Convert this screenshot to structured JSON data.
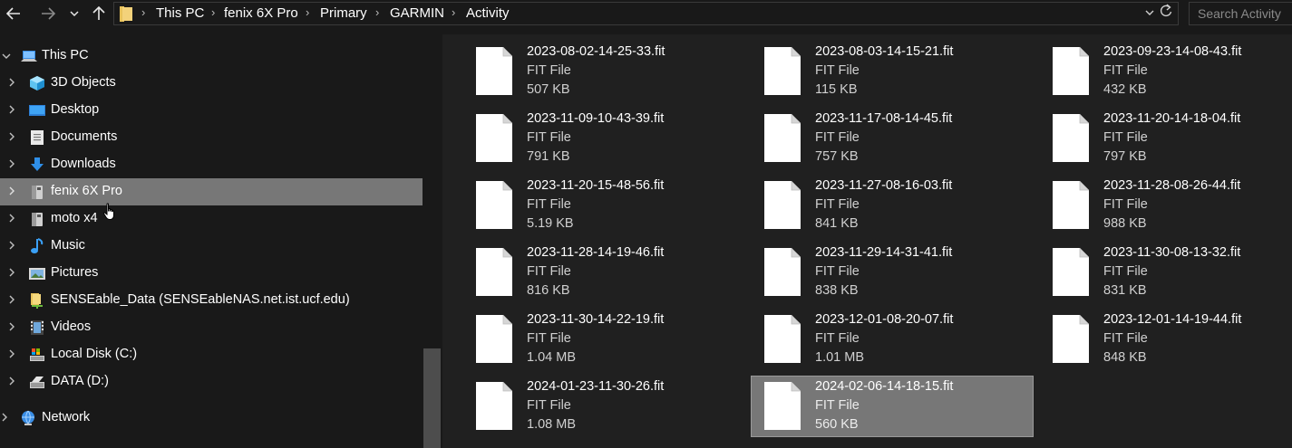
{
  "breadcrumb": [
    "This PC",
    "fenix 6X Pro",
    "Primary",
    "GARMIN",
    "Activity"
  ],
  "search": {
    "placeholder": "Search Activity"
  },
  "nav": {
    "items": [
      {
        "label": "This PC",
        "icon": "computer-icon",
        "expanded": true
      },
      {
        "label": "3D Objects",
        "icon": "cube-icon"
      },
      {
        "label": "Desktop",
        "icon": "desktop-icon"
      },
      {
        "label": "Documents",
        "icon": "document-icon"
      },
      {
        "label": "Downloads",
        "icon": "download-icon"
      },
      {
        "label": "fenix 6X Pro",
        "icon": "device-icon",
        "selected": true
      },
      {
        "label": "moto x4",
        "icon": "device-icon"
      },
      {
        "label": "Music",
        "icon": "music-icon"
      },
      {
        "label": "Pictures",
        "icon": "pictures-icon"
      },
      {
        "label": "SENSEable_Data (SENSEableNAS.net.ist.ucf.edu)",
        "icon": "network-drive-icon"
      },
      {
        "label": "Videos",
        "icon": "video-icon"
      },
      {
        "label": "Local Disk (C:)",
        "icon": "local-disk-icon"
      },
      {
        "label": "DATA (D:)",
        "icon": "drive-icon"
      },
      {
        "label": "Network",
        "icon": "network-icon"
      }
    ]
  },
  "files": [
    {
      "name": "2023-08-02-14-25-33.fit",
      "type": "FIT File",
      "size": "507 KB"
    },
    {
      "name": "2023-08-03-14-15-21.fit",
      "type": "FIT File",
      "size": "115 KB"
    },
    {
      "name": "2023-09-23-14-08-43.fit",
      "type": "FIT File",
      "size": "432 KB"
    },
    {
      "name": "2023-11-09-10-43-39.fit",
      "type": "FIT File",
      "size": "791 KB"
    },
    {
      "name": "2023-11-17-08-14-45.fit",
      "type": "FIT File",
      "size": "757 KB"
    },
    {
      "name": "2023-11-20-14-18-04.fit",
      "type": "FIT File",
      "size": "797 KB"
    },
    {
      "name": "2023-11-20-15-48-56.fit",
      "type": "FIT File",
      "size": "5.19 KB"
    },
    {
      "name": "2023-11-27-08-16-03.fit",
      "type": "FIT File",
      "size": "841 KB"
    },
    {
      "name": "2023-11-28-08-26-44.fit",
      "type": "FIT File",
      "size": "988 KB"
    },
    {
      "name": "2023-11-28-14-19-46.fit",
      "type": "FIT File",
      "size": "816 KB"
    },
    {
      "name": "2023-11-29-14-31-41.fit",
      "type": "FIT File",
      "size": "838 KB"
    },
    {
      "name": "2023-11-30-08-13-32.fit",
      "type": "FIT File",
      "size": "831 KB"
    },
    {
      "name": "2023-11-30-14-22-19.fit",
      "type": "FIT File",
      "size": "1.04 MB"
    },
    {
      "name": "2023-12-01-08-20-07.fit",
      "type": "FIT File",
      "size": "1.01 MB"
    },
    {
      "name": "2023-12-01-14-19-44.fit",
      "type": "FIT File",
      "size": "848 KB"
    },
    {
      "name": "2024-01-23-11-30-26.fit",
      "type": "FIT File",
      "size": "1.08 MB"
    },
    {
      "name": "2024-02-06-14-18-15.fit",
      "type": "FIT File",
      "size": "560 KB",
      "selected": true
    }
  ]
}
